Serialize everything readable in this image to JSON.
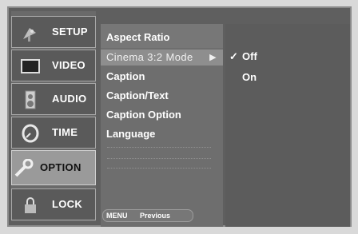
{
  "sidebar": {
    "items": [
      {
        "label": "SETUP",
        "icon": "satellite-dish-icon",
        "selected": false
      },
      {
        "label": "VIDEO",
        "icon": "tv-screen-icon",
        "selected": false
      },
      {
        "label": "AUDIO",
        "icon": "speaker-icon",
        "selected": false
      },
      {
        "label": "TIME",
        "icon": "clock-icon",
        "selected": false
      },
      {
        "label": "OPTION",
        "icon": "wrench-icon",
        "selected": true
      },
      {
        "label": "LOCK",
        "icon": "padlock-icon",
        "selected": false
      }
    ]
  },
  "menu": {
    "items": [
      {
        "label": "Aspect Ratio"
      },
      {
        "label": "Cinema 3:2 Mode",
        "highlighted": true,
        "arrow": "▶"
      },
      {
        "label": "Caption"
      },
      {
        "label": "Caption/Text"
      },
      {
        "label": "Caption Option"
      },
      {
        "label": "Language"
      }
    ]
  },
  "submenu": {
    "check_mark": "✓",
    "options": [
      {
        "label": "Off",
        "checked": true
      },
      {
        "label": "On",
        "checked": false
      }
    ]
  },
  "footer": {
    "key": "MENU",
    "action": "Previous"
  },
  "colors": {
    "frame": "#5f5f5f",
    "selected_tab": "#9a9a9a",
    "highlight_row": "#8e8e8e",
    "text": "#ffffff"
  }
}
